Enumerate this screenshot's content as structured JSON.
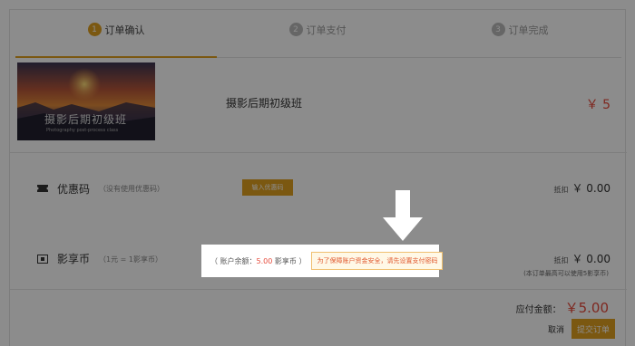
{
  "steps": [
    {
      "num": "1",
      "label": "订单确认"
    },
    {
      "num": "2",
      "label": "订单支付"
    },
    {
      "num": "3",
      "label": "订单完成"
    }
  ],
  "course": {
    "thumb_title": "摄影后期初级班",
    "thumb_subtitle": "Photography post-process class",
    "name": "摄影后期初级班",
    "price": "￥ 5"
  },
  "coupon": {
    "label": "优惠码",
    "hint": "（没有使用优惠码）",
    "button": "输入优惠码",
    "deduct_prefix": "抵扣",
    "deduct_amount": "￥ 0.00"
  },
  "coins": {
    "label": "影享币",
    "hint": "（1元 = 1影享币）",
    "deduct_prefix": "抵扣",
    "deduct_amount": "￥ 0.00",
    "note": "(本订单最高可以使用5影享币)"
  },
  "balance": {
    "prefix": "（ 账户余额：",
    "amount": "5.00",
    "suffix": " 影享币 ）",
    "tip_text": "为了保障账户资金安全，请先 ",
    "tip_link": "设置支付密码"
  },
  "total": {
    "label": "应付金额：",
    "amount": "￥5.00"
  },
  "actions": {
    "cancel": "取消",
    "submit": "提交订单"
  },
  "colors": {
    "accent": "#e0a020",
    "price": "#e64a3b"
  }
}
